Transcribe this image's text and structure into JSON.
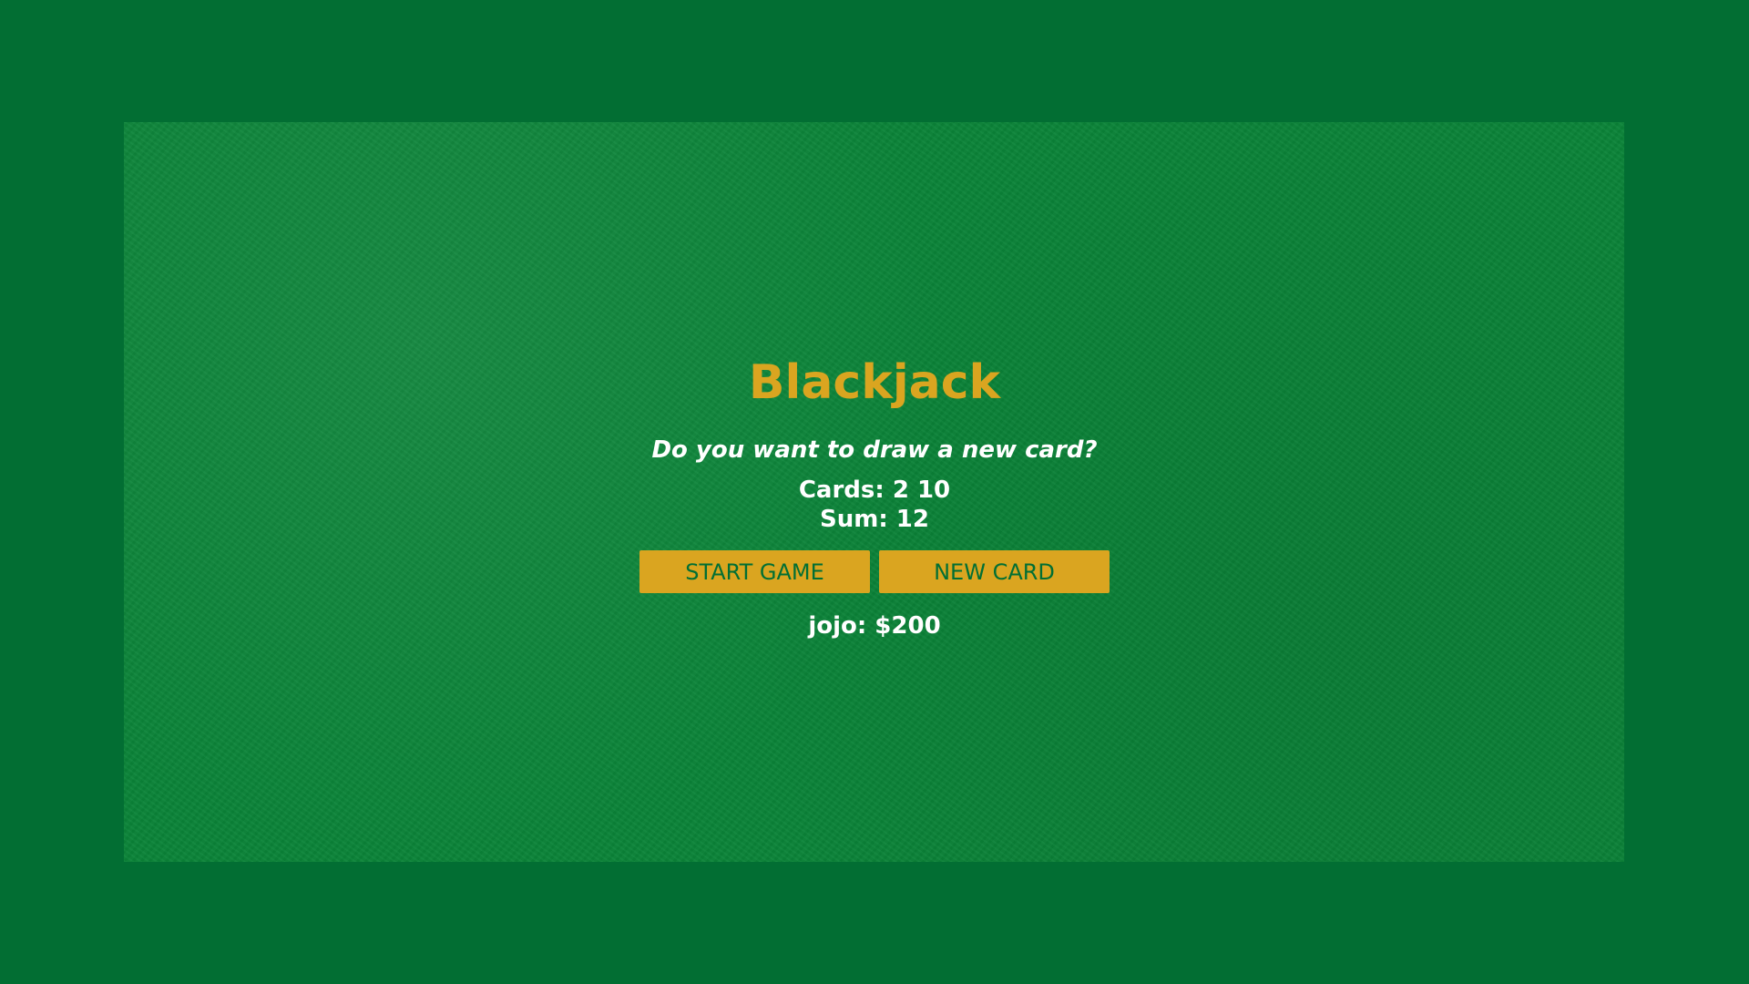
{
  "game": {
    "title": "Blackjack",
    "message": "Do you want to draw a new card?",
    "cards_text": "Cards: 2 10",
    "sum_text": "Sum: 12",
    "player_text": "jojo: $200"
  },
  "controls": {
    "start_label": "START GAME",
    "new_card_label": "NEW CARD"
  },
  "colors": {
    "page_bg": "#026e33",
    "felt": "#0a8438",
    "accent_gold": "#daa520",
    "text": "#ffffff"
  }
}
